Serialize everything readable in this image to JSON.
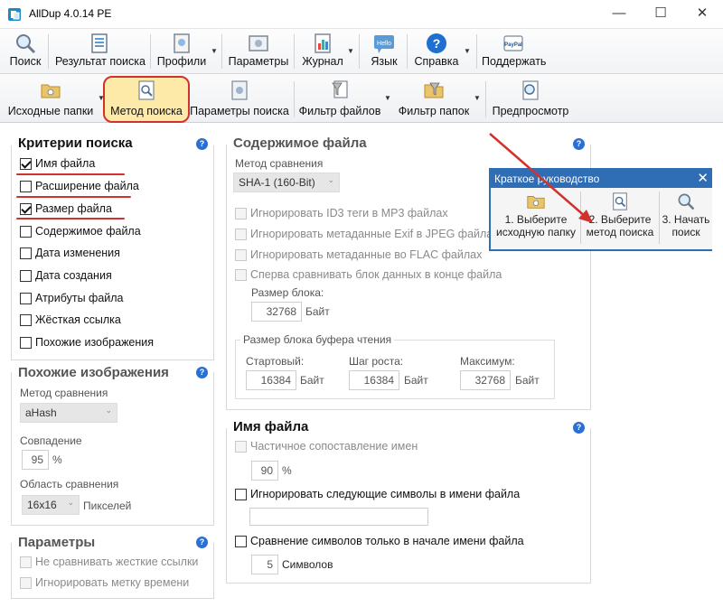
{
  "window": {
    "title": "AllDup 4.0.14 PE"
  },
  "toolbar_main": {
    "search": "Поиск",
    "results": "Результат поиска",
    "profiles": "Профили",
    "parameters": "Параметры",
    "journal": "Журнал",
    "language": "Язык",
    "help": "Справка",
    "support": "Поддержать",
    "hello_badge": "Hello",
    "paypal_badge": "PayPal"
  },
  "toolbar_tabs": {
    "source_folders": "Исходные папки",
    "search_method": "Метод поиска",
    "search_params": "Параметры поиска",
    "file_filter": "Фильтр файлов",
    "folder_filter": "Фильтр папок",
    "preview": "Предпросмотр"
  },
  "criteria": {
    "title": "Критерии поиска",
    "items": [
      {
        "label": "Имя файла",
        "checked": true
      },
      {
        "label": "Расширение файла",
        "checked": false
      },
      {
        "label": "Размер файла",
        "checked": true
      },
      {
        "label": "Содержимое файла",
        "checked": false
      },
      {
        "label": "Дата изменения",
        "checked": false
      },
      {
        "label": "Дата создания",
        "checked": false
      },
      {
        "label": "Атрибуты файла",
        "checked": false
      },
      {
        "label": "Жёсткая ссылка",
        "checked": false
      },
      {
        "label": "Похожие изображения",
        "checked": false
      }
    ]
  },
  "similar_images": {
    "title": "Похожие изображения",
    "method_label": "Метод сравнения",
    "method_value": "aHash",
    "match_label": "Совпадение",
    "match_value": "95",
    "match_unit": "%",
    "area_label": "Область сравнения",
    "area_value": "16x16",
    "area_unit": "Пикселей"
  },
  "parameters": {
    "title": "Параметры",
    "items": [
      {
        "label": "Не сравнивать жесткие ссылки"
      },
      {
        "label": "Игнорировать метку времени"
      }
    ]
  },
  "file_content": {
    "title": "Содержимое файла",
    "method_label": "Метод сравнения",
    "method_value": "SHA-1 (160-Bit)",
    "options": [
      {
        "label": "Игнорировать ID3 теги в MP3 файлах"
      },
      {
        "label": "Игнорировать метаданные Exif в JPEG файлах"
      },
      {
        "label": "Игнорировать метаданные во FLAC файлах"
      },
      {
        "label": "Сперва сравнивать блок данных в конце файла"
      }
    ],
    "block_size_label": "Размер блока:",
    "block_size_value": "32768",
    "block_size_unit": "Байт",
    "buffer_title": "Размер блока буфера чтения",
    "start_label": "Стартовый:",
    "start_value": "16384",
    "step_label": "Шаг роста:",
    "step_value": "16384",
    "max_label": "Максимум:",
    "max_value": "32768",
    "unit": "Байт"
  },
  "filename": {
    "title": "Имя файла",
    "partial_label": "Частичное сопоставление имен",
    "partial_value": "90",
    "partial_unit": "%",
    "ignore_chars_label": "Игнорировать следующие символы в имени файла",
    "ignore_chars_value": "",
    "begin_compare_label": "Сравнение символов только в начале имени файла",
    "begin_compare_value": "5",
    "begin_compare_unit": "Символов"
  },
  "quick_guide": {
    "title": "Краткое руководство",
    "steps": [
      {
        "line1": "1. Выберите",
        "line2": "исходную папку"
      },
      {
        "line1": "2. Выберите",
        "line2": "метод поиска"
      },
      {
        "line1": "3. Начать",
        "line2": "поиск"
      }
    ]
  },
  "colors": {
    "accent_red": "#d2322d",
    "guide_blue": "#2f6db5",
    "selected_tab_bg": "#fde9a8",
    "help_blue": "#2a6fd6"
  },
  "icons": [
    "app-icon",
    "magnifier-icon",
    "results-icon",
    "profiles-icon",
    "parameters-icon",
    "journal-icon",
    "language-icon",
    "help-icon",
    "paypal-icon",
    "folder-icon",
    "filter-icon",
    "preview-icon",
    "close-icon",
    "arrow-icon"
  ]
}
